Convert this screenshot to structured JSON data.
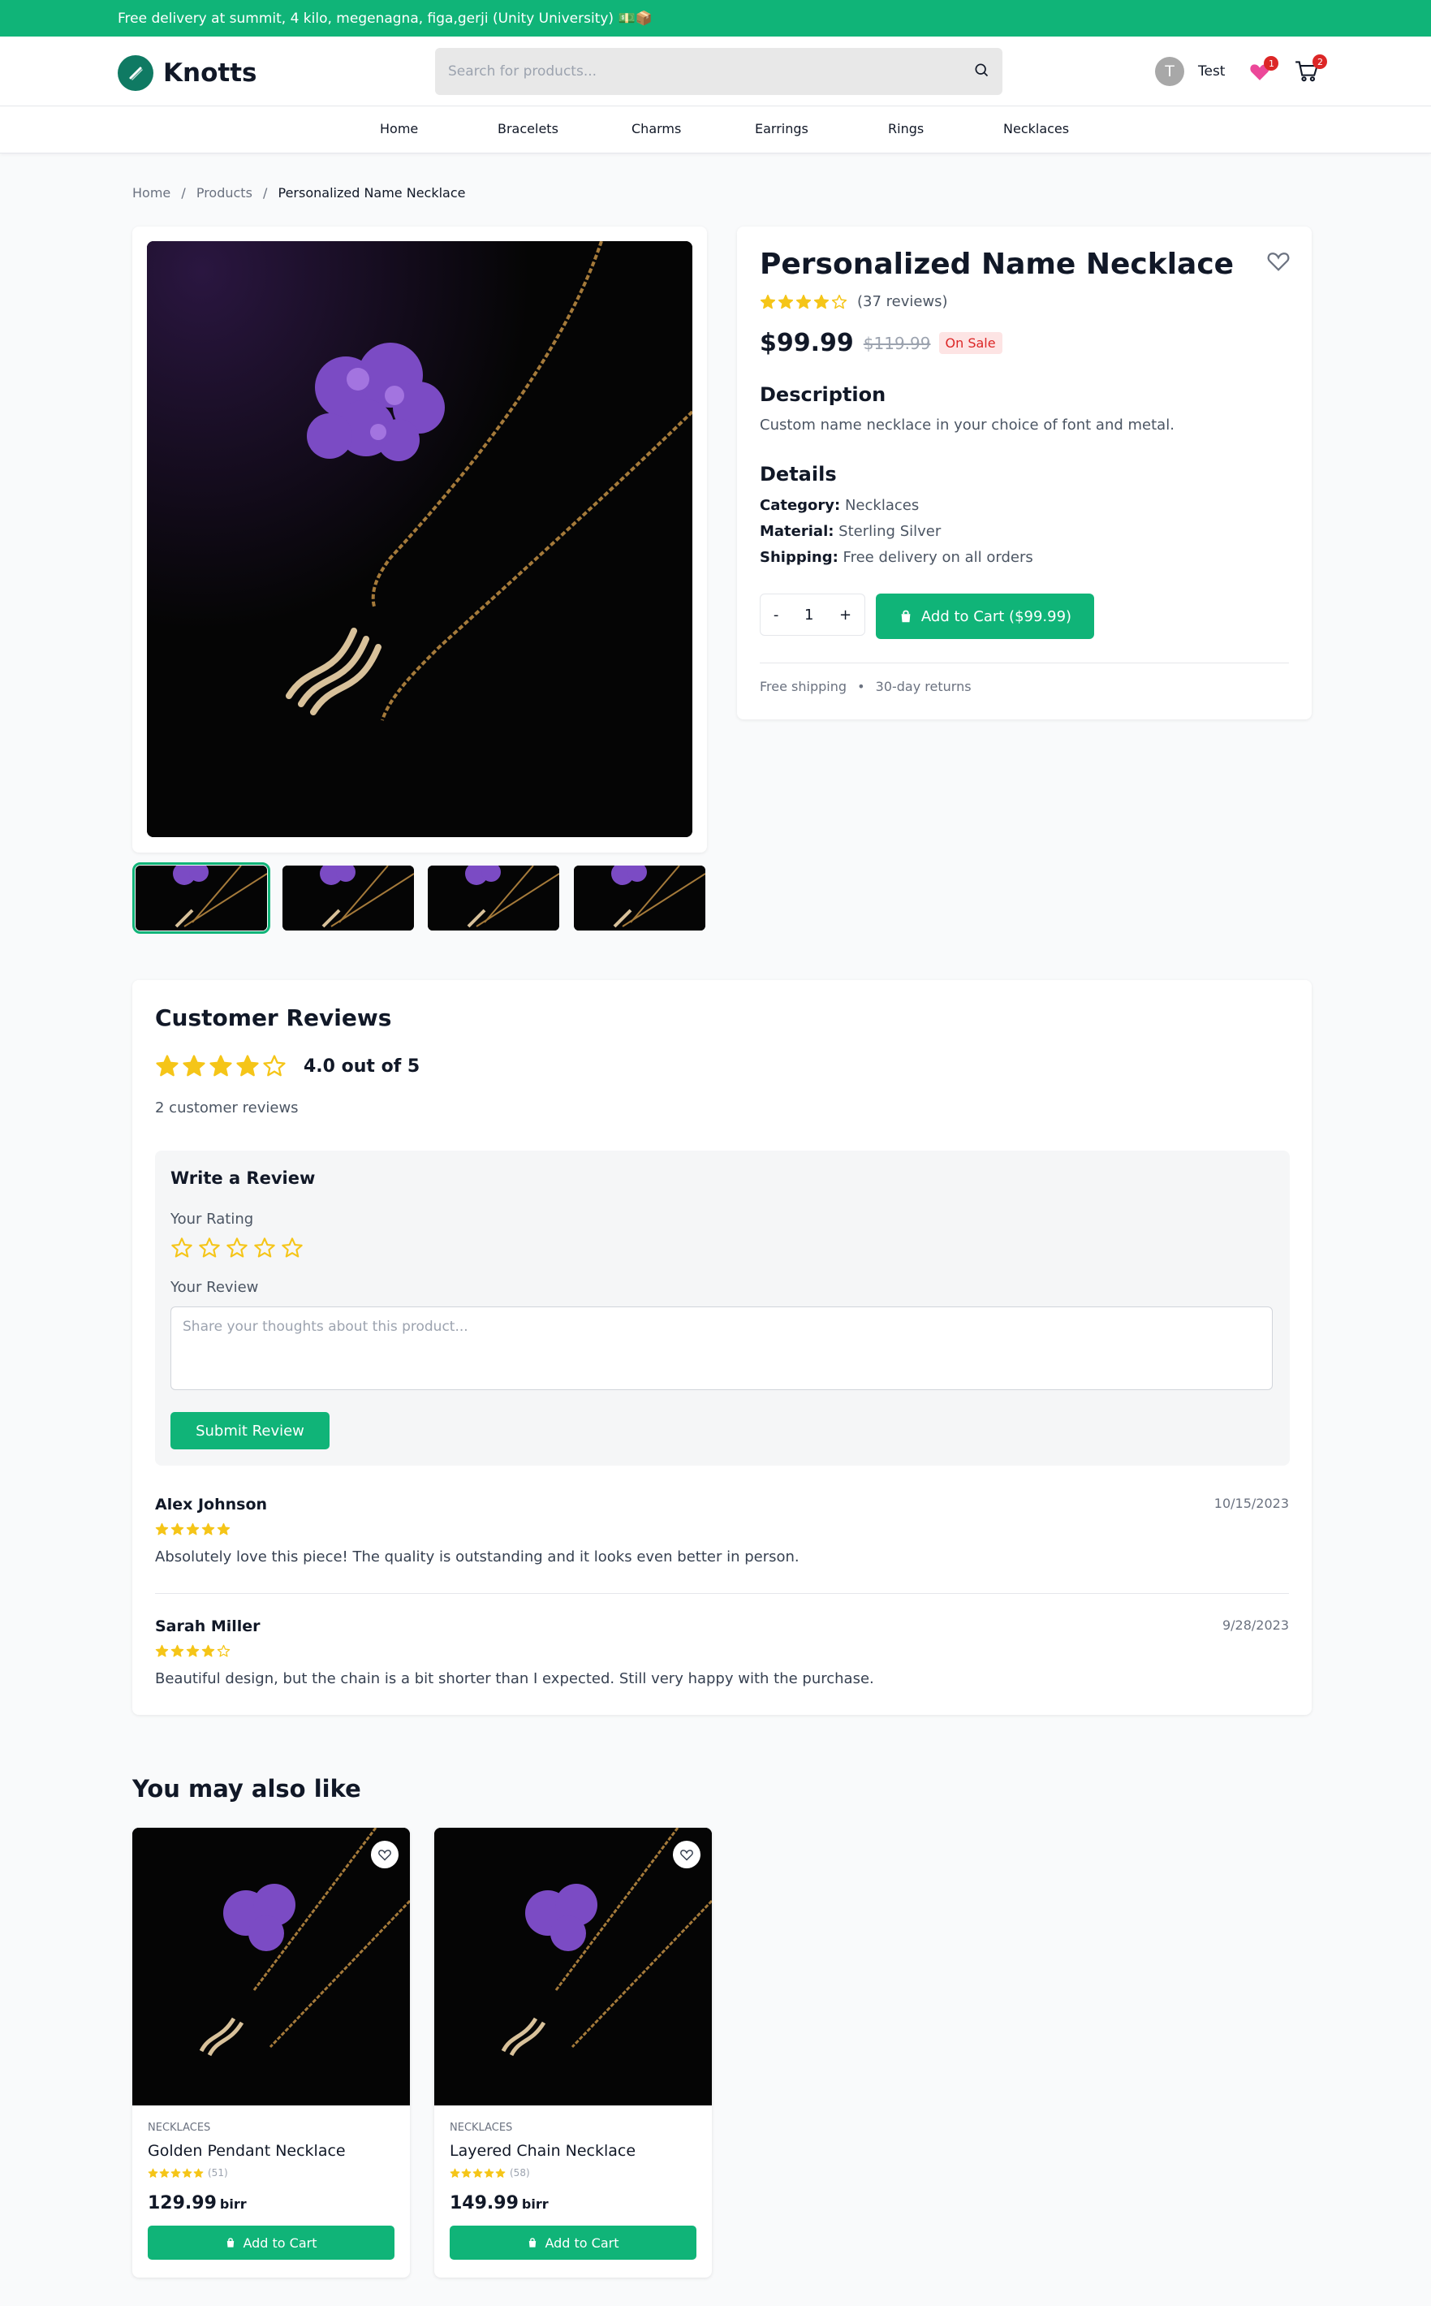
{
  "announcement": "Free delivery at summit, 4 kilo, megenagna, figa,gerji (Unity University) 💵📦",
  "header": {
    "brand": "Knotts",
    "search_placeholder": "Search for products...",
    "user_initial": "T",
    "user_name": "Test",
    "wishlist_count": "1",
    "cart_count": "2"
  },
  "nav": {
    "items": [
      "Home",
      "Bracelets",
      "Charms",
      "Earrings",
      "Rings",
      "Necklaces"
    ]
  },
  "breadcrumb": {
    "home": "Home",
    "products": "Products",
    "current": "Personalized Name Necklace",
    "separator": "/"
  },
  "product": {
    "title": "Personalized Name Necklace",
    "rating": 4,
    "reviews_text": "(37 reviews)",
    "price": "$99.99",
    "old_price": "$119.99",
    "sale_badge": "On Sale",
    "description_heading": "Description",
    "description": "Custom name necklace in your choice of font and metal.",
    "details_heading": "Details",
    "category_label": "Category:",
    "category": "Necklaces",
    "material_label": "Material:",
    "material": "Sterling Silver",
    "shipping_label": "Shipping:",
    "shipping": "Free delivery on all orders",
    "qty_minus": "-",
    "qty": "1",
    "qty_plus": "+",
    "add_to_cart": "Add to Cart ($99.99)",
    "shipping_note": "Free shipping",
    "returns_note": "30-day returns",
    "thumbnail_count": 4
  },
  "reviews": {
    "title": "Customer Reviews",
    "average_rating": 4,
    "average_text": "4.0 out of 5",
    "count_text": "2 customer reviews",
    "write_title": "Write a Review",
    "rating_label": "Your Rating",
    "review_label": "Your Review",
    "review_placeholder": "Share your thoughts about this product...",
    "submit": "Submit Review",
    "items": [
      {
        "name": "Alex Johnson",
        "date": "10/15/2023",
        "rating": 5,
        "text": "Absolutely love this piece! The quality is outstanding and it looks even better in person."
      },
      {
        "name": "Sarah Miller",
        "date": "9/28/2023",
        "rating": 4,
        "text": "Beautiful design, but the chain is a bit shorter than I expected. Still very happy with the purchase."
      }
    ]
  },
  "related": {
    "title": "You may also like",
    "items": [
      {
        "category": "NECKLACES",
        "name": "Golden Pendant Necklace",
        "rating": 5,
        "count": "(51)",
        "price": "129.99",
        "currency": "birr",
        "button": "Add to Cart"
      },
      {
        "category": "NECKLACES",
        "name": "Layered Chain Necklace",
        "rating": 5,
        "count": "(58)",
        "price": "149.99",
        "currency": "birr",
        "button": "Add to Cart"
      }
    ]
  },
  "colors": {
    "accent": "#10b478",
    "star": "#f5c518",
    "sale": "#dc2626"
  }
}
